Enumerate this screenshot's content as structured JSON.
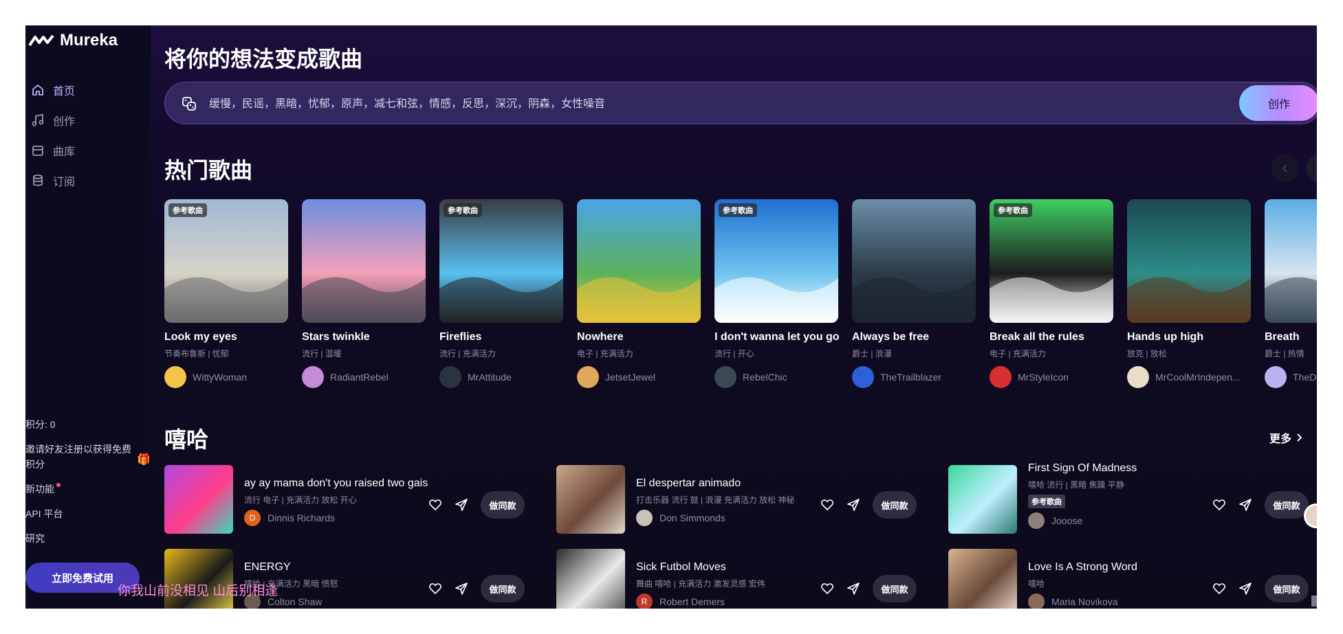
{
  "app": {
    "name": "Mureka"
  },
  "sidebar": {
    "items": [
      {
        "label": "首页",
        "icon": "home-icon",
        "active": true
      },
      {
        "label": "创作",
        "icon": "music-note-icon",
        "active": false
      },
      {
        "label": "曲库",
        "icon": "library-icon",
        "active": false
      },
      {
        "label": "订阅",
        "icon": "database-icon",
        "active": false
      }
    ],
    "points": "积分: 0",
    "invite": "邀请好友注册以获得免费积分",
    "new_features": "新功能",
    "api": "API 平台",
    "research": "研究",
    "try_button": "立即免费试用"
  },
  "lyric_overlay": "你我山前没相见 山后别相逢",
  "main": {
    "title": "将你的想法变成歌曲",
    "prompt_placeholder": "缓慢，民谣，黑暗，忧郁，原声，减七和弦，情感，反思，深沉，阴森，女性噪音",
    "create_button": "创作"
  },
  "hot": {
    "title": "热门歌曲",
    "ref_badge": "参考歌曲",
    "cards": [
      {
        "title": "Look my eyes",
        "tags": "节奏布鲁斯 | 忧郁",
        "author": "WittyWoman",
        "badge": true,
        "colors": [
          "#9fb9d6",
          "#d8d3c8",
          "#6a6d6e"
        ],
        "avatar_color": "#f3c34a"
      },
      {
        "title": "Stars twinkle",
        "tags": "流行 | 温暖",
        "author": "RadiantRebel",
        "badge": false,
        "colors": [
          "#6e8fe0",
          "#f3a0b8",
          "#4d4a56"
        ],
        "avatar_color": "#c58bd8"
      },
      {
        "title": "Fireflies",
        "tags": "流行 | 充满活力",
        "author": "MrAttitude",
        "badge": true,
        "colors": [
          "#3a3d44",
          "#58bff0",
          "#222428"
        ],
        "avatar_color": "#2a3440"
      },
      {
        "title": "Nowhere",
        "tags": "电子 | 充满活力",
        "author": "JetsetJewel",
        "badge": false,
        "colors": [
          "#4aa3e8",
          "#5bb25c",
          "#e8c23a"
        ],
        "avatar_color": "#e0a85a"
      },
      {
        "title": "I don't wanna let you go",
        "tags": "流行 | 开心",
        "author": "RebelChic",
        "badge": true,
        "colors": [
          "#1f6fd0",
          "#6fc4ef",
          "#ffffff"
        ],
        "avatar_color": "#3b4a52"
      },
      {
        "title": "Always be free",
        "tags": "爵士 | 浪漫",
        "author": "TheTrailblazer",
        "badge": false,
        "colors": [
          "#6a8fa8",
          "#2b3b48",
          "#1b2530"
        ],
        "avatar_color": "#2d5fd8"
      },
      {
        "title": "Break all the rules",
        "tags": "电子 | 充满活力",
        "author": "MrStyleIcon",
        "badge": true,
        "colors": [
          "#3fcf64",
          "#1c1c1c",
          "#f5f5f5"
        ],
        "avatar_color": "#d83030"
      },
      {
        "title": "Hands up high",
        "tags": "放克 | 放松",
        "author": "MrCoolMrIndepen...",
        "badge": false,
        "colors": [
          "#1c4a52",
          "#2e8c88",
          "#5a3a22"
        ],
        "avatar_color": "#e9dcc9"
      },
      {
        "title": "Breath",
        "tags": "爵士 | 热情",
        "author": "TheDr",
        "badge": false,
        "colors": [
          "#5aaee6",
          "#d8e4ee",
          "#3a4a58"
        ],
        "avatar_color": "#b9b4ef"
      }
    ]
  },
  "hiphop": {
    "title": "嘻哈",
    "more": "更多",
    "make_label": "做同款",
    "ref_badge": "参考歌曲",
    "songs": [
      {
        "title": "ay ay mama don't you raised two gais",
        "tags": "流行 电子 | 充满活力 放松 开心",
        "author": "Dinnis Richards",
        "avatar_letter": "D",
        "avatar_color": "#e2621b",
        "cover": [
          "#b04ae0",
          "#ff3d8b",
          "#3ad8c0"
        ],
        "badge": false
      },
      {
        "title": "El despertar animado",
        "tags": "打击乐器 流行 鼓 | 浪漫 充满活力 放松 神秘",
        "author": "Don Simmonds",
        "avatar_letter": "",
        "avatar_color": "#c9c2b8",
        "cover": [
          "#c9a88c",
          "#6d4a3a",
          "#e2d6cc"
        ],
        "badge": false
      },
      {
        "title": "First Sign Of Madness",
        "tags": "嘻哈 流行 | 黑暗 焦躁 平静",
        "author": "Jooose",
        "avatar_letter": "",
        "avatar_color": "#8e7f78",
        "cover": [
          "#3ad89a",
          "#bfefff",
          "#2c7a6e"
        ],
        "badge": true
      },
      {
        "title": "ENERGY",
        "tags": "嘻哈 | 充满活力 黑暗 愤怒",
        "author": "Colton Shaw",
        "avatar_letter": "",
        "avatar_color": "#6a5a50",
        "cover": [
          "#e8b81c",
          "#1a1a1a",
          "#f5d94a"
        ],
        "badge": false
      },
      {
        "title": "Sick Futbol Moves",
        "tags": "舞曲 嘻哈 | 充满活力 激发灵感 宏伟",
        "author": "Robert Demers",
        "avatar_letter": "R",
        "avatar_color": "#c0392b",
        "cover": [
          "#2a2a2a",
          "#e8e8e8",
          "#4a4a4a"
        ],
        "badge": false
      },
      {
        "title": "Love Is A Strong Word",
        "tags": "嘻哈",
        "author": "Maria Novikova",
        "avatar_letter": "",
        "avatar_color": "#8a6a5a",
        "cover": [
          "#d8b48c",
          "#6a4a3a",
          "#f2e2d0"
        ],
        "badge": false
      }
    ]
  }
}
